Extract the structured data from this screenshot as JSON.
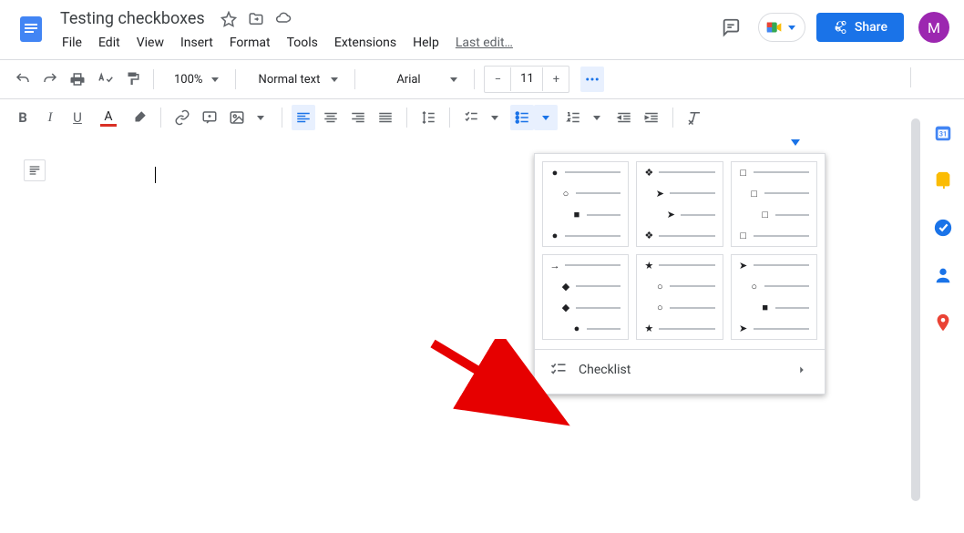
{
  "app": {
    "title": "Testing checkboxes"
  },
  "menubar": {
    "file": "File",
    "edit": "Edit",
    "view": "View",
    "insert": "Insert",
    "format": "Format",
    "tools": "Tools",
    "extensions": "Extensions",
    "help": "Help",
    "last_edit": "Last edit…"
  },
  "header": {
    "share": "Share",
    "avatar_initial": "M"
  },
  "toolbar": {
    "zoom": "100%",
    "paragraph_style": "Normal text",
    "font": "Arial",
    "font_size": "11"
  },
  "bullet_panel": {
    "checklist_label": "Checklist"
  }
}
